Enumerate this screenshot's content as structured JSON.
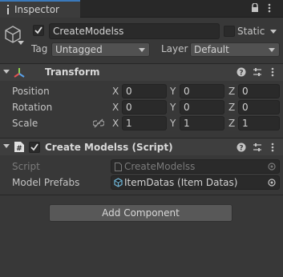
{
  "tab": {
    "label": "Inspector"
  },
  "object": {
    "name": "CreateModelss",
    "static_label": "Static",
    "tag_label": "Tag",
    "tag_value": "Untagged",
    "layer_label": "Layer",
    "layer_value": "Default"
  },
  "transform": {
    "title": "Transform",
    "position_label": "Position",
    "rotation_label": "Rotation",
    "scale_label": "Scale",
    "position": {
      "x": "0",
      "y": "0",
      "z": "0"
    },
    "rotation": {
      "x": "0",
      "y": "0",
      "z": "0"
    },
    "scale": {
      "x": "1",
      "y": "1",
      "z": "1"
    },
    "axes": {
      "x": "X",
      "y": "Y",
      "z": "Z"
    }
  },
  "script_component": {
    "title": "Create Modelss (Script)",
    "script_label": "Script",
    "script_value": "CreateModelss",
    "prefabs_label": "Model Prefabs",
    "prefabs_value": "ItemDatas (Item Datas)"
  },
  "add_component": "Add Component",
  "colors": {
    "accent": "#3a79bb",
    "background": "#383838"
  }
}
